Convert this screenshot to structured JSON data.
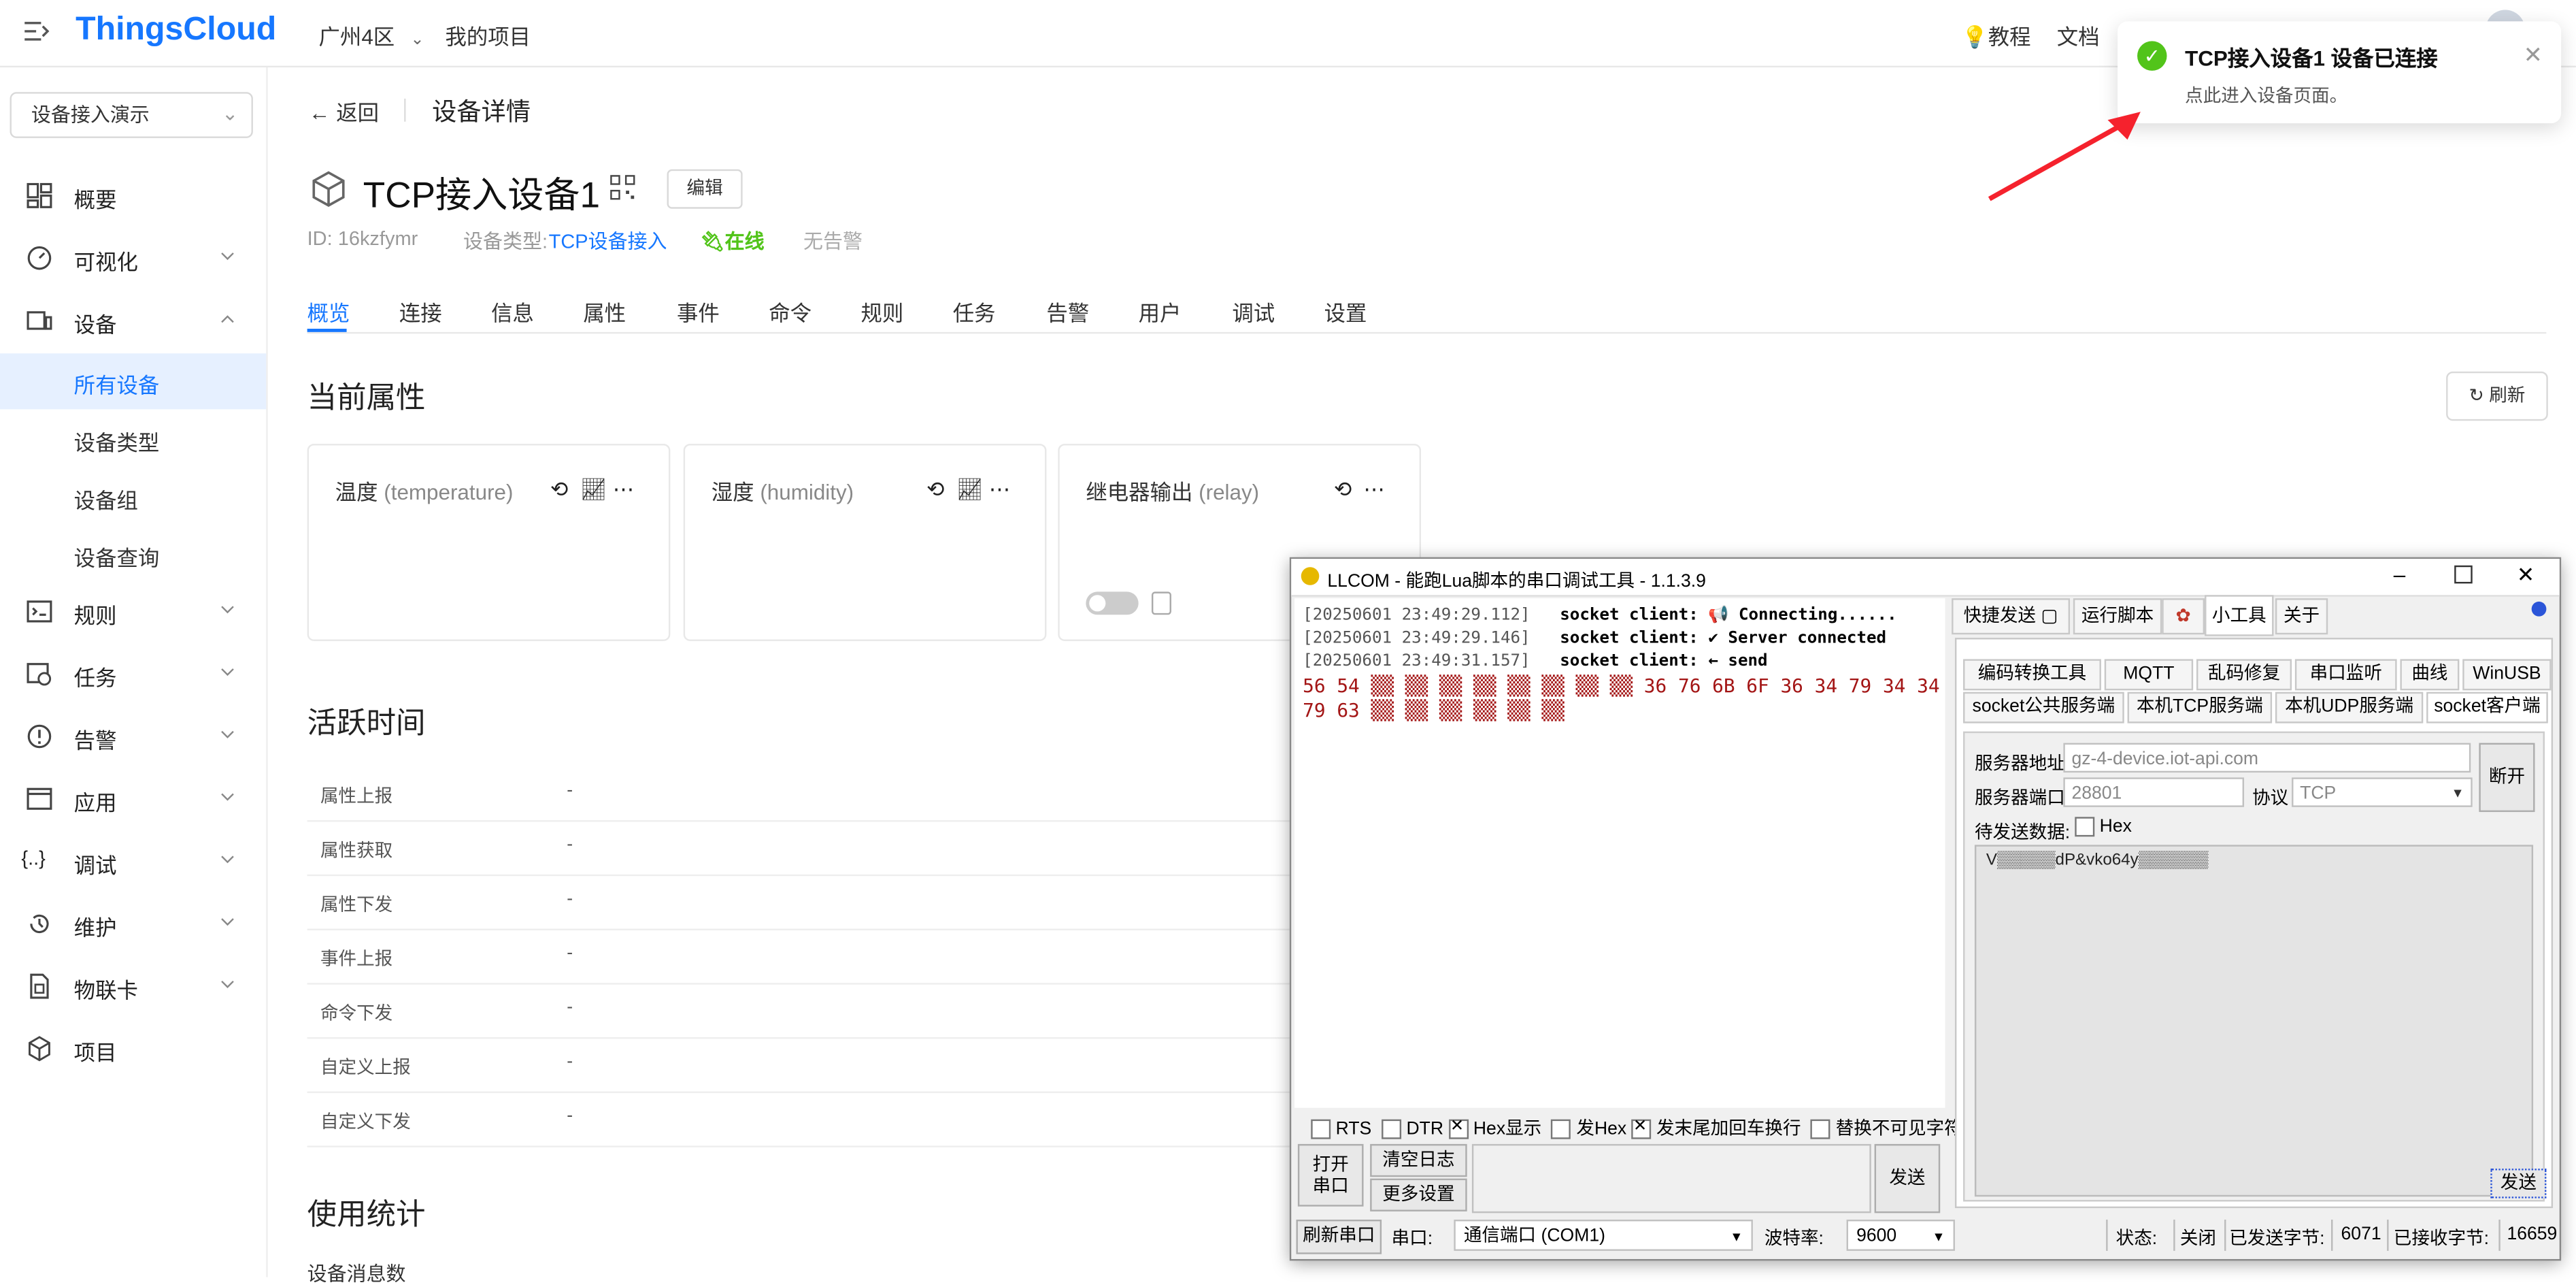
{
  "app": {
    "logo": "ThingsCloud",
    "region": "广州4区",
    "my_projects": "我的项目",
    "tutorial": "教程",
    "docs": "文档"
  },
  "toast": {
    "title": "TCP接入设备1 设备已连接",
    "desc": "点此进入设备页面。"
  },
  "sidebar": {
    "workspace": "设备接入演示",
    "items": [
      {
        "label": "概要"
      },
      {
        "label": "可视化"
      },
      {
        "label": "设备"
      }
    ],
    "sub_items": [
      {
        "label": "所有设备"
      },
      {
        "label": "设备类型"
      },
      {
        "label": "设备组"
      },
      {
        "label": "设备查询"
      }
    ],
    "items2": [
      {
        "label": "规则"
      },
      {
        "label": "任务"
      },
      {
        "label": "告警"
      },
      {
        "label": "应用"
      },
      {
        "label": "调试"
      },
      {
        "label": "维护"
      },
      {
        "label": "物联卡"
      },
      {
        "label": "项目"
      }
    ]
  },
  "page": {
    "back": "返回",
    "title": "设备详情",
    "device_name": "TCP接入设备1",
    "edit": "编辑",
    "id": "ID: 16kzfymr",
    "type_label": "设备类型:",
    "type_value": "TCP设备接入",
    "online": "在线",
    "no_alarm": "无告警",
    "tabs": [
      "概览",
      "连接",
      "信息",
      "属性",
      "事件",
      "命令",
      "规则",
      "任务",
      "告警",
      "用户",
      "调试",
      "设置"
    ],
    "current_props_title": "当前属性",
    "refresh": "刷新",
    "props": [
      {
        "name": "温度",
        "key": "(temperature)"
      },
      {
        "name": "湿度",
        "key": "(humidity)"
      },
      {
        "name": "继电器输出",
        "key": "(relay)"
      }
    ],
    "activity_title": "活跃时间",
    "activity_rows": [
      {
        "k": "属性上报",
        "v": "-"
      },
      {
        "k": "属性获取",
        "v": "-"
      },
      {
        "k": "属性下发",
        "v": "-"
      },
      {
        "k": "事件上报",
        "v": "-"
      },
      {
        "k": "命令下发",
        "v": "-"
      },
      {
        "k": "自定义上报",
        "v": "-"
      },
      {
        "k": "自定义下发",
        "v": "-"
      }
    ],
    "usage_title": "使用统计",
    "usage_sub": "设备消息数"
  },
  "llcom": {
    "title": "LLCOM - 能跑Lua脚本的串口调试工具 - 1.1.3.9",
    "log": [
      {
        "ts": "[20250601 23:49:29.112]",
        "msg": "socket client: 📢 Connecting......"
      },
      {
        "ts": "[20250601 23:49:29.146]",
        "msg": "socket client: ✔ Server connected"
      },
      {
        "ts": "[20250601 23:49:31.157]",
        "msg": "socket client: ← send"
      }
    ],
    "hex_line1": "56 54 ▒▒ ▒▒ ▒▒ ▒▒ ▒▒ ▒▒ ▒▒ ▒▒ 36 76 6B 6F 36 34 79 34 34",
    "hex_line2": "79 63 ▒▒ ▒▒ ▒▒ ▒▒ ▒▒ ▒▒",
    "options": {
      "rts": "RTS",
      "dtr": "DTR",
      "hex_display": "Hex显示",
      "send_hex": "发Hex",
      "append_crlf": "发末尾加回车换行",
      "replace_invisible": "替换不可见字符"
    },
    "open_port": "打开串口",
    "clear_log": "清空日志",
    "more_settings": "更多设置",
    "send": "发送",
    "tabs_top": [
      "快捷发送",
      "运行脚本",
      "小工具",
      "关于"
    ],
    "tools_row1": [
      "编码转换工具",
      "MQTT",
      "乱码修复",
      "串口监听",
      "曲线",
      "WinUSB"
    ],
    "tools_row2": [
      "socket公共服务端",
      "本机TCP服务端",
      "本机UDP服务端",
      "socket客户端"
    ],
    "server_addr_label": "服务器地址",
    "server_addr": "gz-4-device.iot-api.com",
    "server_port_label": "服务器端口",
    "server_port": "28801",
    "protocol_label": "协议",
    "protocol": "TCP",
    "disconnect": "断开",
    "pending_label": "待发送数据:",
    "hex": "Hex",
    "pending_data": "V▒▒▒▒▒dP&vko64y▒▒▒▒▒▒",
    "send2": "发送",
    "status": {
      "refresh_port": "刷新串口",
      "port_label": "串口:",
      "port_value": "通信端口 (COM1)",
      "baud_label": "波特率:",
      "baud_value": "9600",
      "state_label": "状态:",
      "state_value": "关闭",
      "sent_label": "已发送字节:",
      "sent_value": "6071",
      "recv_label": "已接收字节:",
      "recv_value": "16659"
    }
  },
  "colors": {
    "brand": "#1677ff",
    "online": "#52c41a",
    "hex_text": "#a31515",
    "arrow": "#f5222d"
  }
}
